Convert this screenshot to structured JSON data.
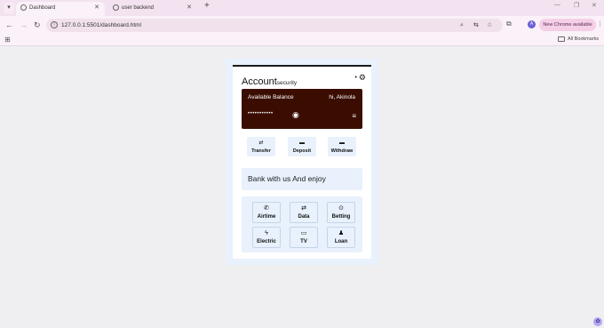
{
  "browser": {
    "tabs": [
      {
        "title": "Dashboard",
        "active": true
      },
      {
        "title": "user backend",
        "active": false
      }
    ],
    "url": "127.0.0.1:5501/dashboard.html",
    "new_chrome_label": "New Chrome available",
    "profile_initial": "A",
    "all_bookmarks_label": "All Bookmarks"
  },
  "page": {
    "header": {
      "title": "Account",
      "subtitle": "security"
    },
    "balance_card": {
      "label": "Available Balance",
      "greeting": "hi, Akinola",
      "masked_balance": "•••••••••••"
    },
    "quick_actions": [
      {
        "label": "Transfer",
        "icon": "transfer-icon",
        "glyph": "⇄"
      },
      {
        "label": "Deposit",
        "icon": "deposit-icon",
        "glyph": "▬"
      },
      {
        "label": "Withdraw",
        "icon": "withdraw-icon",
        "glyph": "▬"
      }
    ],
    "promo_text": "Bank with us And enjoy",
    "services": [
      {
        "label": "Airtime",
        "icon": "phone-icon",
        "glyph": "✆"
      },
      {
        "label": "Data",
        "icon": "data-transfer-icon",
        "glyph": "⇄"
      },
      {
        "label": "Betting",
        "icon": "betting-icon",
        "glyph": "⊙"
      },
      {
        "label": "Electric",
        "icon": "bolt-icon",
        "glyph": "ϟ"
      },
      {
        "label": "TV",
        "icon": "tv-icon",
        "glyph": "▭"
      },
      {
        "label": "Loan",
        "icon": "loan-icon",
        "glyph": "♟"
      }
    ]
  },
  "colors": {
    "balance_card_bg": "#3a0d00",
    "panel_bg": "#e8f1fc",
    "tab_strip_bg": "#f3e2ef"
  }
}
